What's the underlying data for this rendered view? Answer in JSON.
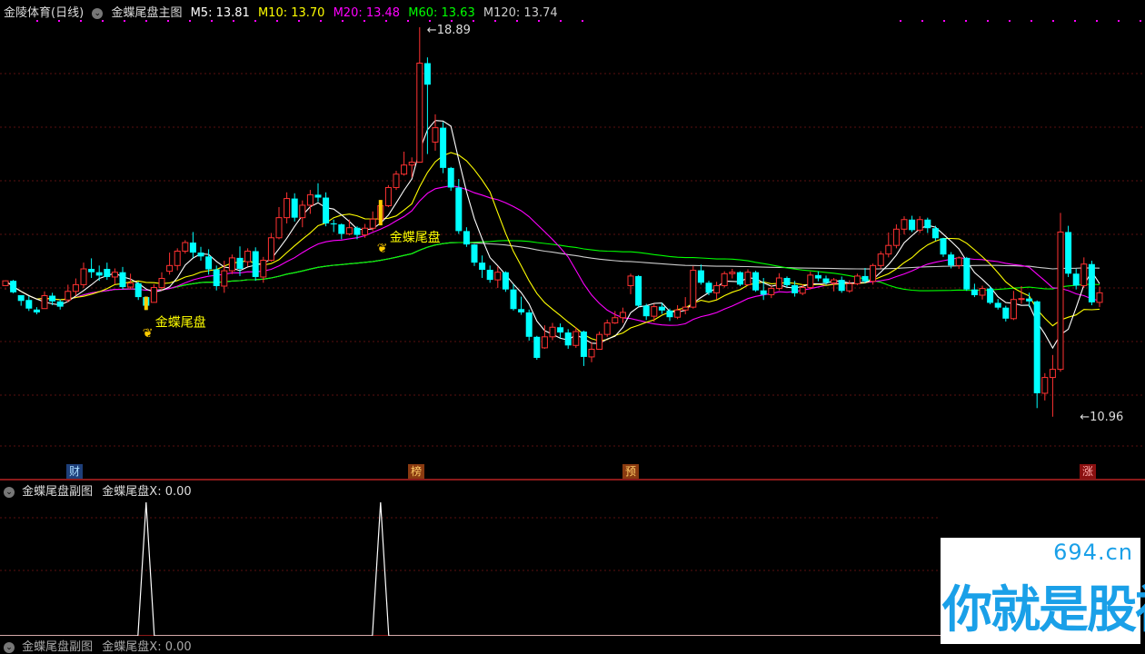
{
  "header": {
    "stock": "金陵体育(日线)",
    "indicator": "金蝶尾盘主图",
    "ma": [
      {
        "label": "M5: 13.81",
        "color": "#ffffff"
      },
      {
        "label": "M10: 13.70",
        "color": "#ffff00"
      },
      {
        "label": "M20: 13.48",
        "color": "#ff00ff"
      },
      {
        "label": "M60: 13.63",
        "color": "#00ff00"
      },
      {
        "label": "M120: 13.74",
        "color": "#cccccc"
      }
    ]
  },
  "events": [
    {
      "label": "财",
      "bg": "#1e3f7a",
      "color": "#aaddff"
    },
    {
      "label": "榜",
      "bg": "#8a3a10",
      "color": "#ffcc66"
    },
    {
      "label": "预",
      "bg": "#8a3a10",
      "color": "#ffcc66"
    },
    {
      "label": "涨",
      "bg": "#8a1010",
      "color": "#ffaaaa"
    }
  ],
  "signal_label": "金蝶尾盘",
  "sub": {
    "title": "金蝶尾盘副图",
    "value_label": "金蝶尾盘X: 0.00",
    "bottom_title": "金蝶尾盘副图",
    "bottom_value": "金蝶尾盘X: 0.00"
  },
  "watermark": {
    "domain": "694.cn",
    "slogan": "你就是股神"
  },
  "colors": {
    "up": "#ff3232",
    "down": "#00ffff",
    "ma5": "#ffffff",
    "ma10": "#ffff00",
    "ma20": "#ff00ff",
    "ma60": "#00ff00",
    "ma120": "#cccccc"
  },
  "chart_data": {
    "type": "candlestick",
    "annotations": {
      "high": "18.89",
      "low": "10.96"
    },
    "candles": [
      [
        13.7,
        13.62,
        13.64,
        13.8
      ],
      [
        13.8,
        13.82,
        13.54,
        13.56
      ],
      [
        13.5,
        13.41,
        13.28,
        13.38
      ],
      [
        13.4,
        13.48,
        13.17,
        13.22
      ],
      [
        13.2,
        13.25,
        13.1,
        13.14
      ],
      [
        13.22,
        13.58,
        13.25,
        13.49
      ],
      [
        13.49,
        13.55,
        13.29,
        13.37
      ],
      [
        13.37,
        13.41,
        13.2,
        13.26
      ],
      [
        13.4,
        13.72,
        13.35,
        13.58
      ],
      [
        13.58,
        13.85,
        13.49,
        13.72
      ],
      [
        13.72,
        14.18,
        13.65,
        14.05
      ],
      [
        14.05,
        14.27,
        13.86,
        13.98
      ],
      [
        13.98,
        14.12,
        13.8,
        13.91
      ],
      [
        14.05,
        14.18,
        13.82,
        13.88
      ],
      [
        13.88,
        14.06,
        13.73,
        13.98
      ],
      [
        13.98,
        14.09,
        13.62,
        13.67
      ],
      [
        13.67,
        13.95,
        13.62,
        13.75
      ],
      [
        13.75,
        13.78,
        13.4,
        13.46
      ],
      [
        13.46,
        13.47,
        13.19,
        13.28
      ],
      [
        13.35,
        13.73,
        13.35,
        13.66
      ],
      [
        13.66,
        13.98,
        13.6,
        13.85
      ],
      [
        14.0,
        14.39,
        13.93,
        14.12
      ],
      [
        14.12,
        14.48,
        14.02,
        14.42
      ],
      [
        14.42,
        14.65,
        14.37,
        14.6
      ],
      [
        14.6,
        14.82,
        14.28,
        14.39
      ],
      [
        14.39,
        14.51,
        14.22,
        14.31
      ],
      [
        14.31,
        14.46,
        13.93,
        14.04
      ],
      [
        14.04,
        14.12,
        13.6,
        13.69
      ],
      [
        13.69,
        14.22,
        13.55,
        14.01
      ],
      [
        14.01,
        14.35,
        13.94,
        14.28
      ],
      [
        14.28,
        14.52,
        13.9,
        14.05
      ],
      [
        14.2,
        14.48,
        14.1,
        14.42
      ],
      [
        14.42,
        14.5,
        13.8,
        13.88
      ],
      [
        13.88,
        14.3,
        13.76,
        14.23
      ],
      [
        14.23,
        14.8,
        14.2,
        14.7
      ],
      [
        14.7,
        15.34,
        14.67,
        15.12
      ],
      [
        15.12,
        15.65,
        15.0,
        15.52
      ],
      [
        15.52,
        15.63,
        15.04,
        15.12
      ],
      [
        15.12,
        15.48,
        14.92,
        15.38
      ],
      [
        15.38,
        15.7,
        15.2,
        15.6
      ],
      [
        15.6,
        15.84,
        15.45,
        15.54
      ],
      [
        15.54,
        15.65,
        14.94,
        15.0
      ],
      [
        15.0,
        15.08,
        14.82,
        14.98
      ],
      [
        14.98,
        15.0,
        14.67,
        14.78
      ],
      [
        14.78,
        15.08,
        14.75,
        14.91
      ],
      [
        14.91,
        14.94,
        14.67,
        14.76
      ],
      [
        14.76,
        14.99,
        14.7,
        14.9
      ],
      [
        14.9,
        15.25,
        14.84,
        15.09
      ],
      [
        15.09,
        15.49,
        14.96,
        15.37
      ],
      [
        15.37,
        15.8,
        15.34,
        15.75
      ],
      [
        15.75,
        16.1,
        15.7,
        16.03
      ],
      [
        16.03,
        16.5,
        16.0,
        16.22
      ],
      [
        16.22,
        16.38,
        15.96,
        16.28
      ],
      [
        16.28,
        19.1,
        16.28,
        18.35
      ],
      [
        18.35,
        18.47,
        16.45,
        17.9
      ],
      [
        16.7,
        17.28,
        16.52,
        17.0
      ],
      [
        17.0,
        17.12,
        16.05,
        16.16
      ],
      [
        16.16,
        16.18,
        15.68,
        15.75
      ],
      [
        15.75,
        15.93,
        14.78,
        14.84
      ],
      [
        14.84,
        14.92,
        14.51,
        14.56
      ],
      [
        14.56,
        14.57,
        14.11,
        14.18
      ],
      [
        14.18,
        14.33,
        13.86,
        14.03
      ],
      [
        14.03,
        14.12,
        13.76,
        13.82
      ],
      [
        13.82,
        14.1,
        13.65,
        13.98
      ],
      [
        13.98,
        14.0,
        13.57,
        13.62
      ],
      [
        13.62,
        13.73,
        13.18,
        13.21
      ],
      [
        13.21,
        13.47,
        13.09,
        13.14
      ],
      [
        13.14,
        13.2,
        12.55,
        12.63
      ],
      [
        12.63,
        12.65,
        12.15,
        12.19
      ],
      [
        12.4,
        12.87,
        12.38,
        12.63
      ],
      [
        12.63,
        12.92,
        12.56,
        12.83
      ],
      [
        12.83,
        12.91,
        12.6,
        12.72
      ],
      [
        12.72,
        12.79,
        12.38,
        12.45
      ],
      [
        12.45,
        12.83,
        12.4,
        12.74
      ],
      [
        12.74,
        12.76,
        12.02,
        12.21
      ],
      [
        12.21,
        12.51,
        12.1,
        12.37
      ],
      [
        12.37,
        12.74,
        12.36,
        12.68
      ],
      [
        12.68,
        12.99,
        12.63,
        12.92
      ],
      [
        12.92,
        13.17,
        12.9,
        13.03
      ],
      [
        13.03,
        13.24,
        12.92,
        13.14
      ],
      [
        13.7,
        13.95,
        13.52,
        13.9
      ],
      [
        13.9,
        13.92,
        13.25,
        13.28
      ],
      [
        13.28,
        13.32,
        12.98,
        13.06
      ],
      [
        13.06,
        13.32,
        12.94,
        13.26
      ],
      [
        13.26,
        13.34,
        13.11,
        13.18
      ],
      [
        13.18,
        13.22,
        12.96,
        13.04
      ],
      [
        13.04,
        13.29,
        13.0,
        13.19
      ],
      [
        13.19,
        13.46,
        13.1,
        13.25
      ],
      [
        13.25,
        14.11,
        13.22,
        14.02
      ],
      [
        14.02,
        14.14,
        13.72,
        13.76
      ],
      [
        13.76,
        13.8,
        13.5,
        13.55
      ],
      [
        13.55,
        13.78,
        13.41,
        13.7
      ],
      [
        13.7,
        14.0,
        13.66,
        13.95
      ],
      [
        13.95,
        14.05,
        13.85,
        13.98
      ],
      [
        13.98,
        14.0,
        13.69,
        13.72
      ],
      [
        13.72,
        14.04,
        13.7,
        13.98
      ],
      [
        13.98,
        14.01,
        13.57,
        13.6
      ],
      [
        13.6,
        13.86,
        13.4,
        13.51
      ],
      [
        13.51,
        13.7,
        13.44,
        13.64
      ],
      [
        13.64,
        13.96,
        13.6,
        13.86
      ],
      [
        13.86,
        13.89,
        13.66,
        13.71
      ],
      [
        13.71,
        13.8,
        13.47,
        13.54
      ],
      [
        13.54,
        13.73,
        13.5,
        13.66
      ],
      [
        13.66,
        13.99,
        13.62,
        13.92
      ],
      [
        13.92,
        14.0,
        13.79,
        13.85
      ],
      [
        13.85,
        13.91,
        13.72,
        13.76
      ],
      [
        13.76,
        13.86,
        13.58,
        13.82
      ],
      [
        13.82,
        13.89,
        13.55,
        13.59
      ],
      [
        13.59,
        13.81,
        13.55,
        13.74
      ],
      [
        13.74,
        13.95,
        13.71,
        13.9
      ],
      [
        13.9,
        14.07,
        13.75,
        13.79
      ],
      [
        13.79,
        14.16,
        13.72,
        14.12
      ],
      [
        14.12,
        14.42,
        14.06,
        14.36
      ],
      [
        14.36,
        14.81,
        14.29,
        14.54
      ],
      [
        14.54,
        14.98,
        14.48,
        14.88
      ],
      [
        14.88,
        15.15,
        14.77,
        15.08
      ],
      [
        15.08,
        15.16,
        14.82,
        14.86
      ],
      [
        14.86,
        15.15,
        14.8,
        15.08
      ],
      [
        15.08,
        15.12,
        14.8,
        14.9
      ],
      [
        14.9,
        14.95,
        14.64,
        14.69
      ],
      [
        14.69,
        14.7,
        14.3,
        14.35
      ],
      [
        14.35,
        14.4,
        14.06,
        14.12
      ],
      [
        14.12,
        14.31,
        14.05,
        14.28
      ],
      [
        14.28,
        14.3,
        13.59,
        13.62
      ],
      [
        13.62,
        13.74,
        13.46,
        13.5
      ],
      [
        13.5,
        13.7,
        13.41,
        13.64
      ],
      [
        13.64,
        13.68,
        13.31,
        13.34
      ],
      [
        13.34,
        13.42,
        13.2,
        13.24
      ],
      [
        13.24,
        13.28,
        12.95,
        13.01
      ],
      [
        13.01,
        13.59,
        12.98,
        13.41
      ],
      [
        13.41,
        13.69,
        13.32,
        13.43
      ],
      [
        13.43,
        13.55,
        13.25,
        13.37
      ],
      [
        13.37,
        13.39,
        11.14,
        11.45
      ],
      [
        11.45,
        11.87,
        11.3,
        11.78
      ],
      [
        11.78,
        12.25,
        10.96,
        11.95
      ],
      [
        11.95,
        15.22,
        11.9,
        14.82
      ],
      [
        14.82,
        14.95,
        13.88,
        13.95
      ],
      [
        13.95,
        14.05,
        13.62,
        13.7
      ],
      [
        13.7,
        14.29,
        13.65,
        14.15
      ],
      [
        14.15,
        14.22,
        13.29,
        13.35
      ],
      [
        13.35,
        13.68,
        13.25,
        13.55
      ]
    ]
  }
}
